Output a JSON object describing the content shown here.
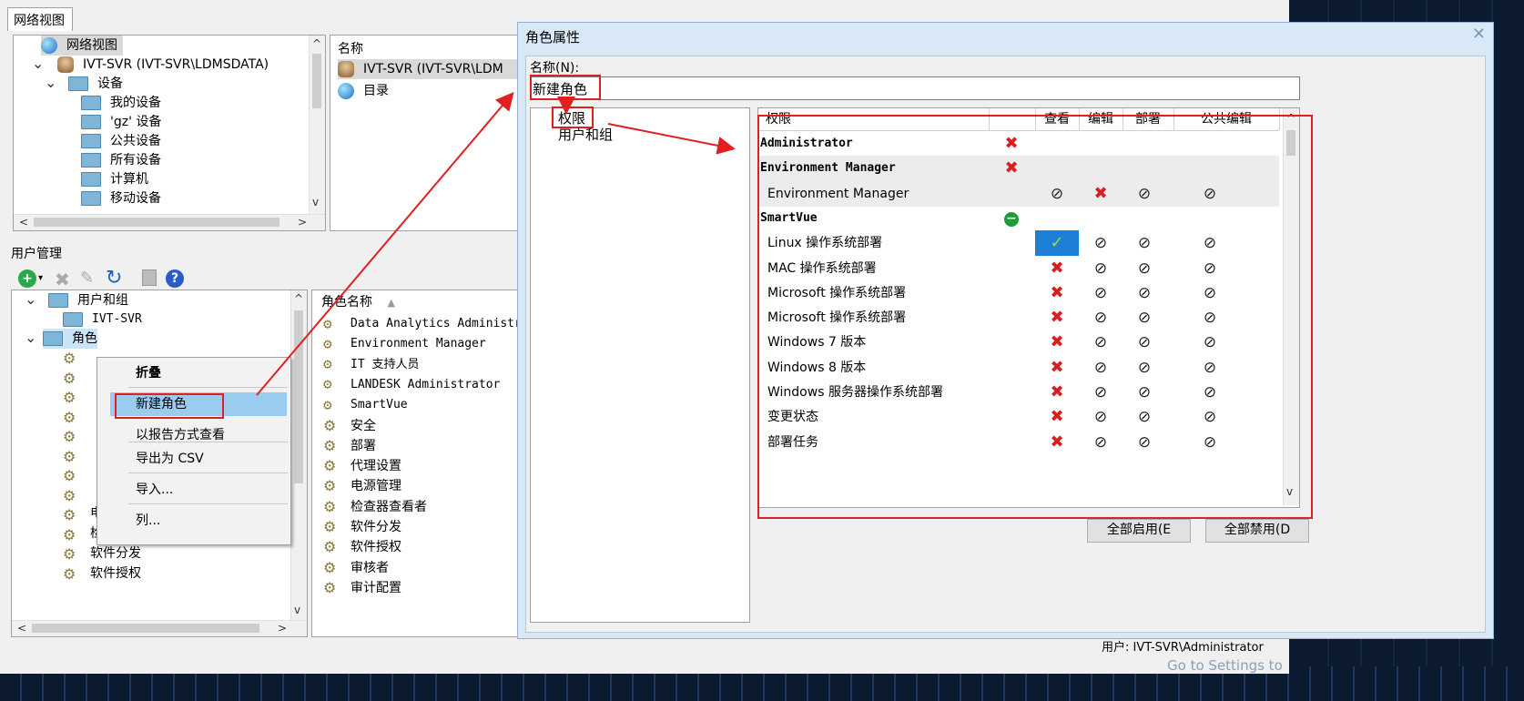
{
  "colors": {
    "accent": "#3399ff",
    "red": "#e02020",
    "dialog_bg": "#d9e8f7"
  },
  "main": {
    "tab_label": "网络视图",
    "nav_tree": [
      {
        "label": "网络视图",
        "icon": "globe-icon"
      },
      {
        "label": "IVT-SVR (IVT-SVR\\LDMSDATA)",
        "icon": "database-icon"
      },
      {
        "label": "设备",
        "icon": "folder-icon"
      },
      {
        "label": "我的设备",
        "icon": "folder-icon"
      },
      {
        "label": "'gz' 设备",
        "icon": "folder-icon"
      },
      {
        "label": "公共设备",
        "icon": "folder-icon"
      },
      {
        "label": "所有设备",
        "icon": "folder-icon"
      },
      {
        "label": "计算机",
        "icon": "folder-icon"
      },
      {
        "label": "移动设备",
        "icon": "folder-icon"
      }
    ],
    "name_panel": {
      "header": "名称",
      "items": [
        {
          "label": "IVT-SVR (IVT-SVR\\LDM",
          "icon": "database-icon"
        },
        {
          "label": "目录",
          "icon": "globe-icon"
        }
      ]
    },
    "user_mgmt_title": "用户管理",
    "user_tree": [
      {
        "label": "用户和组"
      },
      {
        "label": "IVT-SVR"
      },
      {
        "label": "角色"
      }
    ],
    "user_tree_roles": [
      "电源管理",
      "检查器查看者",
      "软件分发",
      "软件授权"
    ],
    "role_list": {
      "header": "角色名称",
      "items": [
        "Data Analytics Administr",
        "Environment Manager",
        "IT 支持人员",
        "LANDESK Administrator",
        "SmartVue",
        "安全",
        "部署",
        "代理设置",
        "电源管理",
        "检查器查看者",
        "软件分发",
        "软件授权",
        "审核者",
        "审计配置"
      ]
    },
    "context_menu": [
      {
        "label": "折叠",
        "bold": true
      },
      {
        "label": "新建角色"
      },
      {
        "label": "以报告方式查看"
      },
      {
        "label": "导出为 CSV"
      },
      {
        "label": "导入..."
      },
      {
        "label": "列..."
      }
    ],
    "status_user": "用户: IVT-SVR\\Administrator",
    "watermark": "Go to Settings to"
  },
  "dialog": {
    "title": "角色属性",
    "name_label": "名称(N):",
    "name_value": "新建角色",
    "left_tree": [
      "权限",
      "用户和组"
    ],
    "grid_headers": [
      "权限",
      "",
      "查看",
      "编辑",
      "部署",
      "公共编辑"
    ],
    "rows": [
      {
        "label": "Administrator",
        "group": true,
        "mark": "x",
        "v": "",
        "e": "",
        "d": "",
        "p": ""
      },
      {
        "label": "Environment Manager",
        "group": true,
        "mark": "x",
        "v": "",
        "e": "",
        "d": "",
        "p": ""
      },
      {
        "label": "Environment Manager",
        "group": false,
        "mark": "",
        "v": "no",
        "e": "x",
        "d": "no",
        "p": "no"
      },
      {
        "label": "SmartVue",
        "group": true,
        "mark": "minus",
        "v": "",
        "e": "",
        "d": "",
        "p": ""
      },
      {
        "label": "Linux 操作系统部署",
        "group": false,
        "mark": "",
        "v": "check",
        "e": "no",
        "d": "no",
        "p": "no"
      },
      {
        "label": "MAC 操作系统部署",
        "group": false,
        "mark": "",
        "v": "x",
        "e": "no",
        "d": "no",
        "p": "no"
      },
      {
        "label": "Microsoft 操作系统部署",
        "group": false,
        "mark": "",
        "v": "x",
        "e": "no",
        "d": "no",
        "p": "no"
      },
      {
        "label": "Microsoft 操作系统部署",
        "group": false,
        "mark": "",
        "v": "x",
        "e": "no",
        "d": "no",
        "p": "no"
      },
      {
        "label": "Windows 7 版本",
        "group": false,
        "mark": "",
        "v": "x",
        "e": "no",
        "d": "no",
        "p": "no"
      },
      {
        "label": "Windows 8 版本",
        "group": false,
        "mark": "",
        "v": "x",
        "e": "no",
        "d": "no",
        "p": "no"
      },
      {
        "label": "Windows 服务器操作系统部署",
        "group": false,
        "mark": "",
        "v": "x",
        "e": "no",
        "d": "no",
        "p": "no"
      },
      {
        "label": "变更状态",
        "group": false,
        "mark": "",
        "v": "x",
        "e": "no",
        "d": "no",
        "p": "no"
      },
      {
        "label": "部署任务",
        "group": false,
        "mark": "",
        "v": "x",
        "e": "no",
        "d": "no",
        "p": "no"
      }
    ],
    "enable_all": "全部启用(E",
    "disable_all": "全部禁用(D"
  }
}
